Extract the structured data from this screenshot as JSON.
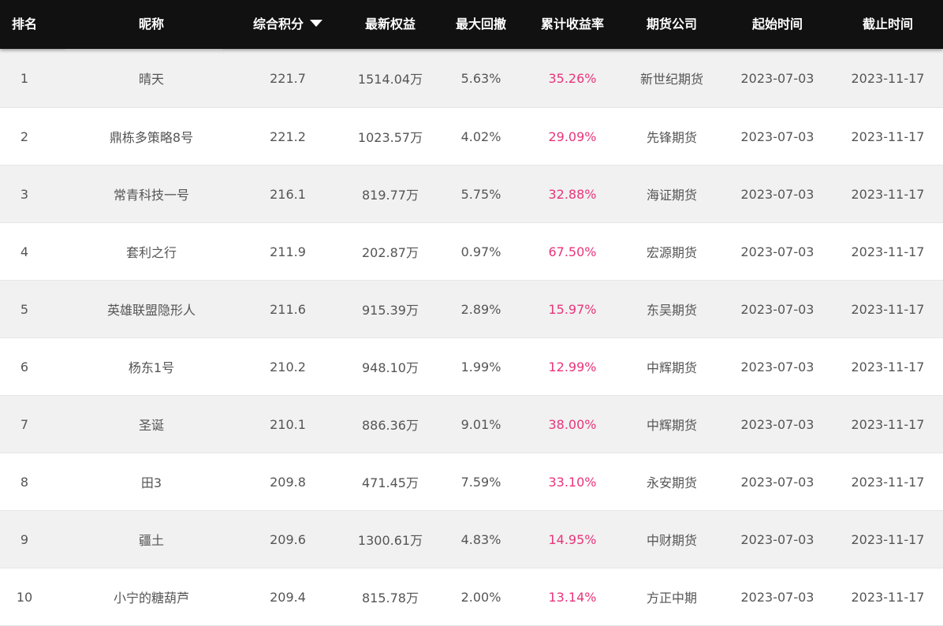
{
  "columns": {
    "rank": "排名",
    "nickname": "昵称",
    "score": "综合积分",
    "equity": "最新权益",
    "drawdown": "最大回撤",
    "return_rate": "累计收益率",
    "company": "期货公司",
    "start": "起始时间",
    "end": "截止时间"
  },
  "sort": {
    "column": "score",
    "direction": "desc",
    "icon": "caret-down-icon"
  },
  "colors": {
    "header_bg": "#111111",
    "header_text": "#ffffff",
    "row_alt": "#f1f1f1",
    "text": "#555555",
    "return_rate": "#e8357a"
  },
  "rows": [
    {
      "rank": "1",
      "nickname": "晴天",
      "score": "221.7",
      "equity": "1514.04万",
      "drawdown": "5.63%",
      "return_rate": "35.26%",
      "company": "新世纪期货",
      "start": "2023-07-03",
      "end": "2023-11-17"
    },
    {
      "rank": "2",
      "nickname": "鼎栋多策略8号",
      "score": "221.2",
      "equity": "1023.57万",
      "drawdown": "4.02%",
      "return_rate": "29.09%",
      "company": "先锋期货",
      "start": "2023-07-03",
      "end": "2023-11-17"
    },
    {
      "rank": "3",
      "nickname": "常青科技一号",
      "score": "216.1",
      "equity": "819.77万",
      "drawdown": "5.75%",
      "return_rate": "32.88%",
      "company": "海证期货",
      "start": "2023-07-03",
      "end": "2023-11-17"
    },
    {
      "rank": "4",
      "nickname": "套利之行",
      "score": "211.9",
      "equity": "202.87万",
      "drawdown": "0.97%",
      "return_rate": "67.50%",
      "company": "宏源期货",
      "start": "2023-07-03",
      "end": "2023-11-17"
    },
    {
      "rank": "5",
      "nickname": "英雄联盟隐形人",
      "score": "211.6",
      "equity": "915.39万",
      "drawdown": "2.89%",
      "return_rate": "15.97%",
      "company": "东吴期货",
      "start": "2023-07-03",
      "end": "2023-11-17"
    },
    {
      "rank": "6",
      "nickname": "杨东1号",
      "score": "210.2",
      "equity": "948.10万",
      "drawdown": "1.99%",
      "return_rate": "12.99%",
      "company": "中辉期货",
      "start": "2023-07-03",
      "end": "2023-11-17"
    },
    {
      "rank": "7",
      "nickname": "圣诞",
      "score": "210.1",
      "equity": "886.36万",
      "drawdown": "9.01%",
      "return_rate": "38.00%",
      "company": "中辉期货",
      "start": "2023-07-03",
      "end": "2023-11-17"
    },
    {
      "rank": "8",
      "nickname": "田3",
      "score": "209.8",
      "equity": "471.45万",
      "drawdown": "7.59%",
      "return_rate": "33.10%",
      "company": "永安期货",
      "start": "2023-07-03",
      "end": "2023-11-17"
    },
    {
      "rank": "9",
      "nickname": "疆土",
      "score": "209.6",
      "equity": "1300.61万",
      "drawdown": "4.83%",
      "return_rate": "14.95%",
      "company": "中财期货",
      "start": "2023-07-03",
      "end": "2023-11-17"
    },
    {
      "rank": "10",
      "nickname": "小宁的糖葫芦",
      "score": "209.4",
      "equity": "815.78万",
      "drawdown": "2.00%",
      "return_rate": "13.14%",
      "company": "方正中期",
      "start": "2023-07-03",
      "end": "2023-11-17"
    }
  ]
}
